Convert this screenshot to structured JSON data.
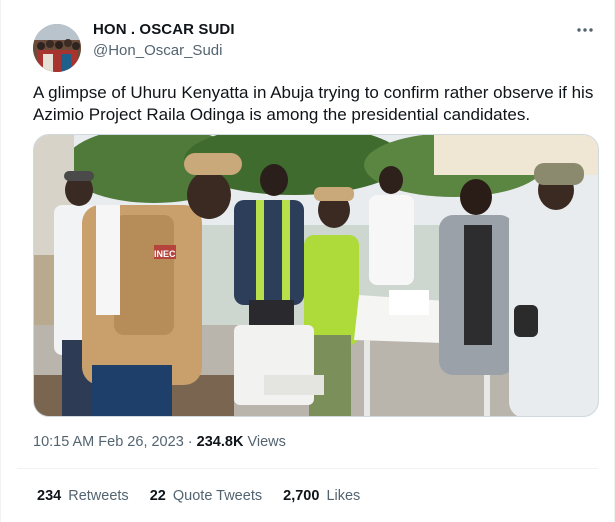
{
  "author": {
    "name": "HON . OSCAR SUDI",
    "handle": "@Hon_Oscar_Sudi",
    "avatar_icon": "crowd-photo-avatar"
  },
  "more_icon": "ellipsis-icon",
  "tweet_text": "A glimpse of Uhuru Kenyatta in Abuja trying to confirm rather observe if his Azimio Project Raila Odinga is among the presidential candidates.",
  "media": {
    "vest_text": "INEC"
  },
  "meta": {
    "time": "10:15 AM",
    "separator": "·",
    "date": "Feb 26, 2023",
    "views_count": "234.8K",
    "views_label": "Views"
  },
  "stats": {
    "retweets_count": "234",
    "retweets_label": "Retweets",
    "quotes_count": "22",
    "quotes_label": "Quote Tweets",
    "likes_count": "2,700",
    "likes_label": "Likes"
  },
  "colors": {
    "text_primary": "#0f1419",
    "text_secondary": "#536471",
    "border": "#cfd9de"
  }
}
